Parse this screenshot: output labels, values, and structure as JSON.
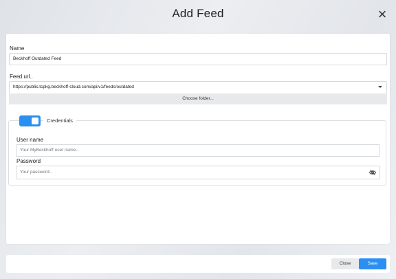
{
  "dialog": {
    "title": "Add Feed",
    "close_icon": "×"
  },
  "form": {
    "name_label": "Name",
    "name_value": "Beckhoff Outdated Feed",
    "feed_url_label": "Feed url..",
    "feed_url_value": "https://public.tcpkg.beckhoff-cloud.com/api/v1/feeds/outdated",
    "choose_folder_label": "Choose folder...",
    "credentials": {
      "legend": "Credentials",
      "enabled": true,
      "toggle_color": "#2a8ff0",
      "username_label": "User name",
      "username_placeholder": "Your MyBeckhoff user name..",
      "password_label": "Password",
      "password_placeholder": "Your password..",
      "password_icon": "eye-slash-icon"
    }
  },
  "footer": {
    "close_label": "Close",
    "save_label": "Save",
    "accent_color": "#2a8ff0"
  }
}
